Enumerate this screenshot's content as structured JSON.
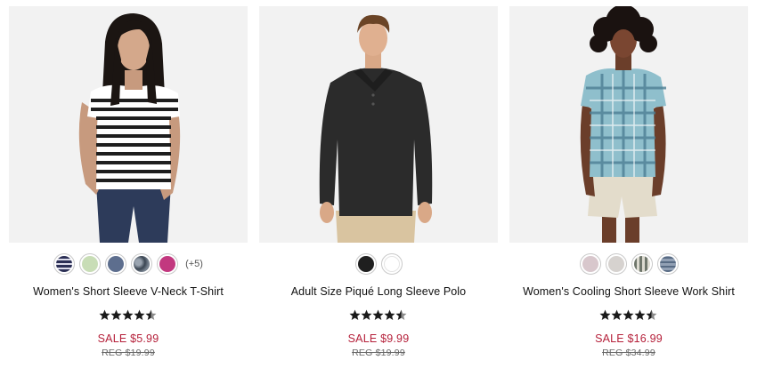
{
  "products": [
    {
      "name": "Women's Short Sleeve V-Neck T-Shirt",
      "sale_price": "SALE $5.99",
      "reg_price": "REG $19.99",
      "rating": 4.5,
      "more_colors": "(+5)",
      "swatch_colors": [
        "#3b3f66",
        "#c8ddb6",
        "#5d6e8e",
        "#3a4552",
        "#c2387f"
      ],
      "image_icon": "woman-striped-tshirt-photo"
    },
    {
      "name": "Adult Size Piqué Long Sleeve Polo",
      "sale_price": "SALE $9.99",
      "reg_price": "REG $19.99",
      "rating": 4.5,
      "more_colors": "",
      "swatch_colors": [
        "#1f1f1f",
        "#ffffff"
      ],
      "image_icon": "man-black-polo-photo"
    },
    {
      "name": "Women's Cooling Short Sleeve Work Shirt",
      "sale_price": "SALE $16.99",
      "reg_price": "REG $34.99",
      "rating": 4.5,
      "more_colors": "",
      "swatch_colors": [
        "#d8c7cc",
        "#d6d2cf",
        "#8a8f86",
        "#a7b3c2"
      ],
      "image_icon": "woman-plaid-shirt-photo"
    }
  ],
  "colors": {
    "sale": "#b5203a",
    "star": "#1a1a1a",
    "photo_bg": "#f2f2f2"
  }
}
